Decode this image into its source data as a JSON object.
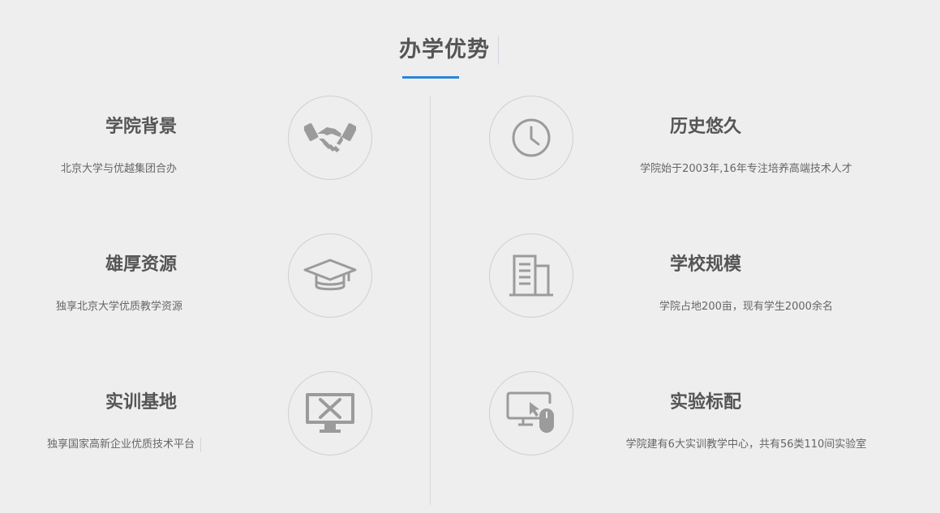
{
  "page": {
    "title": "办学优势"
  },
  "left_features": [
    {
      "title": "学院背景",
      "description": "北京大学与优越集团合办",
      "icon": "handshake-icon"
    },
    {
      "title": "雄厚资源",
      "description": "独享北京大学优质教学资源",
      "icon": "graduation-cap-icon"
    },
    {
      "title": "实训基地",
      "description": "独享国家高新企业优质技术平台",
      "icon": "monitor-tools-icon"
    }
  ],
  "right_features": [
    {
      "title": "历史悠久",
      "description": "学院始于2003年,16年专注培养高端技术人才",
      "icon": "clock-icon"
    },
    {
      "title": "学校规模",
      "description": "学院占地200亩，现有学生2000余名",
      "icon": "building-icon"
    },
    {
      "title": "实验标配",
      "description": "学院建有6大实训教学中心，共有56类110间实验室",
      "icon": "computer-mouse-icon"
    }
  ],
  "colors": {
    "background": "#eeeeee",
    "accent": "#2b86d6",
    "text": "#555555",
    "icon": "#9b9b9b",
    "circle_border": "#cfcfcf"
  }
}
